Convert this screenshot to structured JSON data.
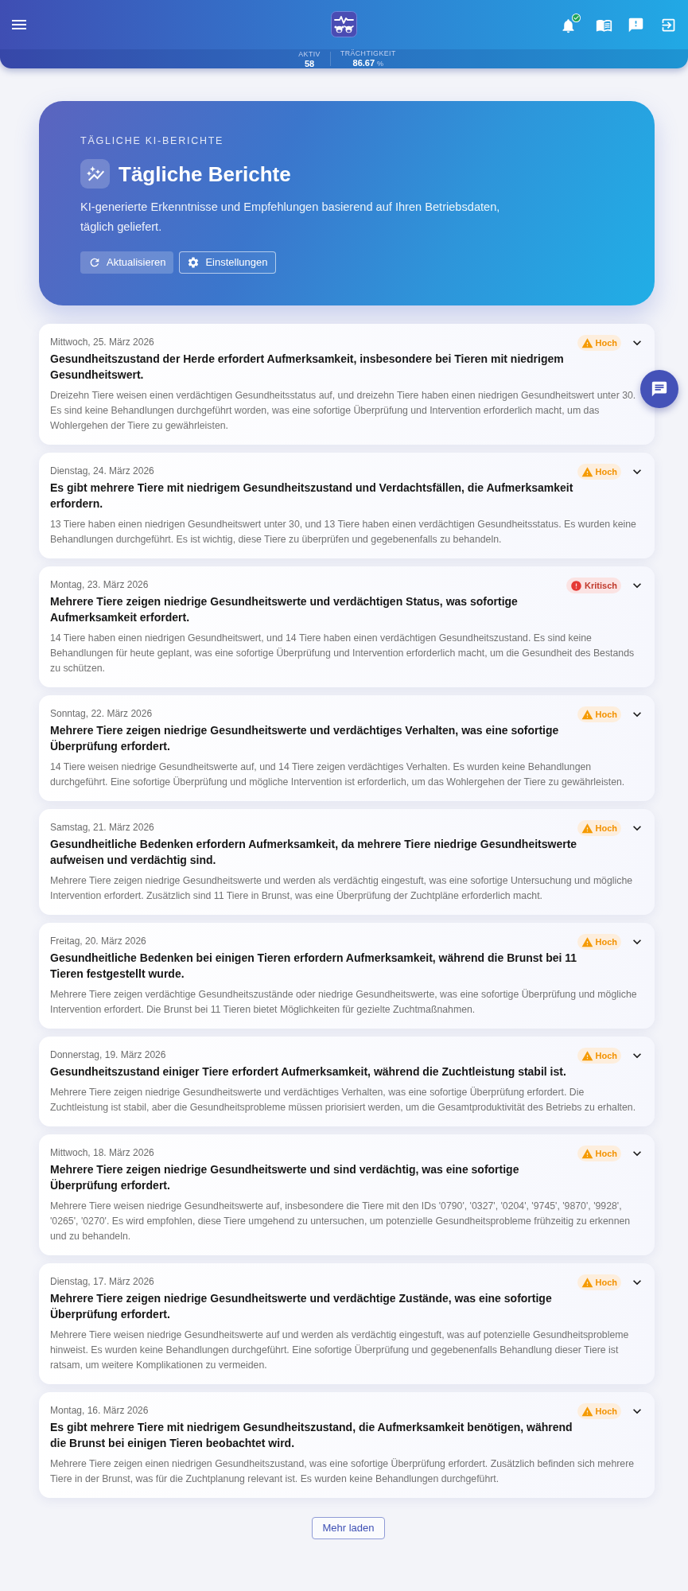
{
  "header": {
    "stats": [
      {
        "label": "AKTIV",
        "value": "58"
      },
      {
        "label": "TRÄCHTIGKEIT",
        "value": "86.67",
        "unit": "%"
      }
    ]
  },
  "hero": {
    "eyebrow": "TÄGLICHE KI-BERICHTE",
    "title": "Tägliche Berichte",
    "description": "KI-generierte Erkenntnisse und Empfehlungen basierend auf Ihren Betriebsdaten, täglich geliefert.",
    "buttons": [
      {
        "kind": "refresh",
        "label": "Aktualisieren"
      },
      {
        "kind": "settings",
        "label": "Einstellungen"
      }
    ]
  },
  "reports": [
    {
      "date": "Mittwoch, 25. März 2026",
      "priority": {
        "kind": "high",
        "label": "Hoch"
      },
      "expanded": false,
      "title": "Gesundheitszustand der Herde erfordert Aufmerksamkeit, insbesondere bei Tieren mit niedrigem Gesundheitswert.",
      "summary": "Dreizehn Tiere weisen einen verdächtigen Gesundheitsstatus auf, und dreizehn Tiere haben einen niedrigen Gesundheitswert unter 30. Es sind keine Behandlungen durchgeführt worden, was eine sofortige Überprüfung und Intervention erforderlich macht, um das Wohlergehen der Tiere zu gewährleisten."
    },
    {
      "date": "Dienstag, 24. März 2026",
      "priority": {
        "kind": "high",
        "label": "Hoch"
      },
      "expanded": false,
      "title": "Es gibt mehrere Tiere mit niedrigem Gesundheitszustand und Verdachtsfällen, die Aufmerksamkeit erfordern.",
      "summary": "13 Tiere haben einen niedrigen Gesundheitswert unter 30, und 13 Tiere haben einen verdächtigen Gesundheitsstatus. Es wurden keine Behandlungen durchgeführt. Es ist wichtig, diese Tiere zu überprüfen und gegebenenfalls zu behandeln."
    },
    {
      "date": "Montag, 23. März 2026",
      "priority": {
        "kind": "critical",
        "label": "Kritisch"
      },
      "expanded": false,
      "title": "Mehrere Tiere zeigen niedrige Gesundheitswerte und verdächtigen Status, was sofortige Aufmerksamkeit erfordert.",
      "summary": "14 Tiere haben einen niedrigen Gesundheitswert, und 14 Tiere haben einen verdächtigen Gesundheitszustand. Es sind keine Behandlungen für heute geplant, was eine sofortige Überprüfung und Intervention erforderlich macht, um die Gesundheit des Bestands zu schützen."
    },
    {
      "date": "Sonntag, 22. März 2026",
      "priority": {
        "kind": "high",
        "label": "Hoch"
      },
      "expanded": false,
      "title": "Mehrere Tiere zeigen niedrige Gesundheitswerte und verdächtiges Verhalten, was eine sofortige Überprüfung erfordert.",
      "summary": "14 Tiere weisen niedrige Gesundheitswerte auf, und 14 Tiere zeigen verdächtiges Verhalten. Es wurden keine Behandlungen durchgeführt. Eine sofortige Überprüfung und mögliche Intervention ist erforderlich, um das Wohlergehen der Tiere zu gewährleisten."
    },
    {
      "date": "Samstag, 21. März 2026",
      "priority": {
        "kind": "high",
        "label": "Hoch"
      },
      "expanded": false,
      "title": "Gesundheitliche Bedenken erfordern Aufmerksamkeit, da mehrere Tiere niedrige Gesundheitswerte aufweisen und verdächtig sind.",
      "summary": "Mehrere Tiere zeigen niedrige Gesundheitswerte und werden als verdächtig eingestuft, was eine sofortige Untersuchung und mögliche Intervention erfordert. Zusätzlich sind 11 Tiere in Brunst, was eine Überprüfung der Zuchtpläne erforderlich macht."
    },
    {
      "date": "Freitag, 20. März 2026",
      "priority": {
        "kind": "high",
        "label": "Hoch"
      },
      "expanded": false,
      "title": "Gesundheitliche Bedenken bei einigen Tieren erfordern Aufmerksamkeit, während die Brunst bei 11 Tieren festgestellt wurde.",
      "summary": "Mehrere Tiere zeigen verdächtige Gesundheitszustände oder niedrige Gesundheitswerte, was eine sofortige Überprüfung und mögliche Intervention erfordert. Die Brunst bei 11 Tieren bietet Möglichkeiten für gezielte Zuchtmaßnahmen."
    },
    {
      "date": "Donnerstag, 19. März 2026",
      "priority": {
        "kind": "high",
        "label": "Hoch"
      },
      "expanded": false,
      "title": "Gesundheitszustand einiger Tiere erfordert Aufmerksamkeit, während die Zuchtleistung stabil ist.",
      "summary": "Mehrere Tiere zeigen niedrige Gesundheitswerte und verdächtiges Verhalten, was eine sofortige Überprüfung erfordert. Die Zuchtleistung ist stabil, aber die Gesundheitsprobleme müssen priorisiert werden, um die Gesamtproduktivität des Betriebs zu erhalten."
    },
    {
      "date": "Mittwoch, 18. März 2026",
      "priority": {
        "kind": "high",
        "label": "Hoch"
      },
      "expanded": false,
      "title": "Mehrere Tiere zeigen niedrige Gesundheitswerte und sind verdächtig, was eine sofortige Überprüfung erfordert.",
      "summary": "Mehrere Tiere weisen niedrige Gesundheitswerte auf, insbesondere die Tiere mit den IDs '0790', '0327', '0204', '9745', '9870', '9928', '0265', '0270'. Es wird empfohlen, diese Tiere umgehend zu untersuchen, um potenzielle Gesundheitsprobleme frühzeitig zu erkennen und zu behandeln."
    },
    {
      "date": "Dienstag, 17. März 2026",
      "priority": {
        "kind": "high",
        "label": "Hoch"
      },
      "expanded": false,
      "title": "Mehrere Tiere zeigen niedrige Gesundheitswerte und verdächtige Zustände, was eine sofortige Überprüfung erfordert.",
      "summary": "Mehrere Tiere weisen niedrige Gesundheitswerte auf und werden als verdächtig eingestuft, was auf potenzielle Gesundheitsprobleme hinweist. Es wurden keine Behandlungen durchgeführt. Eine sofortige Überprüfung und gegebenenfalls Behandlung dieser Tiere ist ratsam, um weitere Komplikationen zu vermeiden."
    },
    {
      "date": "Montag, 16. März 2026",
      "priority": {
        "kind": "high",
        "label": "Hoch"
      },
      "expanded": false,
      "title": "Es gibt mehrere Tiere mit niedrigem Gesundheitszustand, die Aufmerksamkeit benötigen, während die Brunst bei einigen Tieren beobachtet wird.",
      "summary": "Mehrere Tiere zeigen einen niedrigen Gesundheitszustand, was eine sofortige Überprüfung erfordert. Zusätzlich befinden sich mehrere Tiere in der Brunst, was für die Zuchtplanung relevant ist. Es wurden keine Behandlungen durchgeführt."
    }
  ],
  "load_more": "Mehr laden"
}
